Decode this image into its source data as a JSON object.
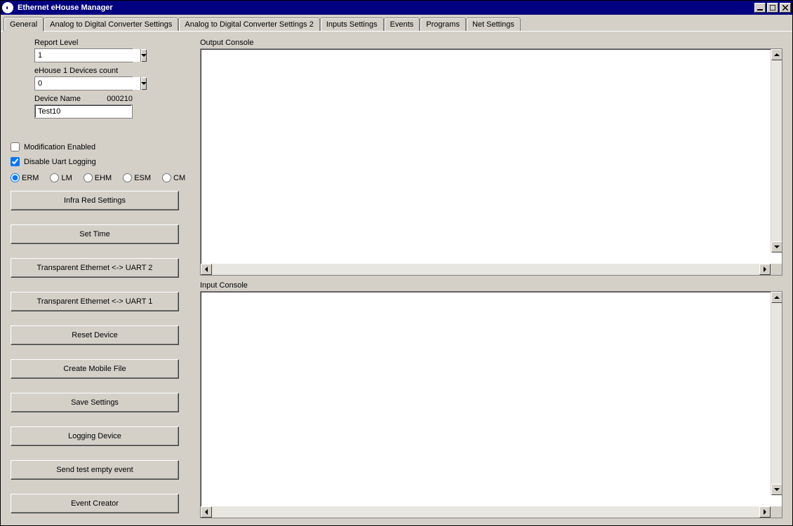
{
  "window": {
    "title": "Ethernet eHouse Manager"
  },
  "tabs": [
    {
      "label": "General",
      "active": true
    },
    {
      "label": "Analog to Digital Converter Settings",
      "active": false
    },
    {
      "label": "Analog to Digital Converter Settings 2",
      "active": false
    },
    {
      "label": "Inputs Settings",
      "active": false
    },
    {
      "label": "Events",
      "active": false
    },
    {
      "label": "Programs",
      "active": false
    },
    {
      "label": "Net Settings",
      "active": false
    }
  ],
  "fields": {
    "report_level_label": "Report Level",
    "report_level_value": "1",
    "device_count_label": "eHouse 1 Devices count",
    "device_count_value": "0",
    "device_name_label": "Device Name",
    "device_name_code": "000210",
    "device_name_value": "Test10"
  },
  "checkboxes": {
    "modification_enabled": {
      "label": "Modification Enabled",
      "checked": false
    },
    "disable_uart_logging": {
      "label": "Disable Uart Logging",
      "checked": true
    }
  },
  "radios": {
    "selected": "ERM",
    "options": [
      "ERM",
      "LM",
      "EHM",
      "ESM",
      "CM"
    ]
  },
  "buttons": {
    "infra_red": "Infra Red Settings",
    "set_time": "Set Time",
    "trans_uart2": "Transparent Ethernet <-> UART 2",
    "trans_uart1": "Transparent Ethernet <-> UART 1",
    "reset_device": "Reset Device",
    "create_mobile": "Create Mobile File",
    "save_settings": "Save Settings",
    "logging_device": "Logging Device",
    "send_test_event": "Send test empty event",
    "event_creator": "Event Creator"
  },
  "consoles": {
    "output_label": "Output Console",
    "input_label": "Input Console",
    "output_content": "",
    "input_content": ""
  }
}
